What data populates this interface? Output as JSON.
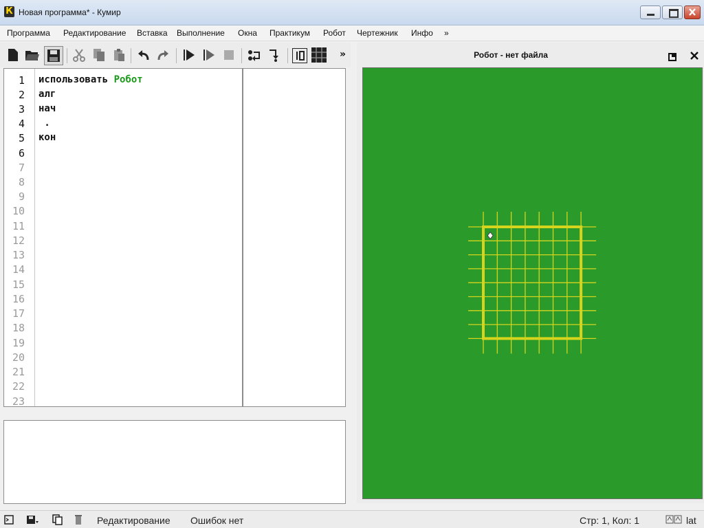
{
  "window": {
    "title": "Новая программа* - Кумир",
    "app_icon_letter": "К"
  },
  "menu": [
    "Программа",
    "Редактирование",
    "Вставка",
    "Выполнение",
    "Окна",
    "Практикум",
    "Робот",
    "Чертежник",
    "Инфо",
    "»"
  ],
  "toolbar": {
    "overflow": "»",
    "icons": [
      "new-file-icon",
      "open-folder-icon",
      "save-icon",
      "cut-icon",
      "copy-icon",
      "paste-icon",
      "undo-icon",
      "redo-icon",
      "run-icon",
      "step-run-icon",
      "stop-icon",
      "step-into-icon",
      "step-out-icon",
      "variables-icon",
      "grid-view-icon"
    ]
  },
  "editor": {
    "line_numbers": [
      "1",
      "2",
      "3",
      "4",
      "5",
      "6",
      "7",
      "8",
      "9",
      "10",
      "11",
      "12",
      "13",
      "14",
      "15",
      "16",
      "17",
      "18",
      "19",
      "20",
      "21",
      "22",
      "23"
    ],
    "lines": [
      {
        "keyword": "использовать",
        "module": "Робот"
      },
      {
        "text": "алг"
      },
      {
        "text": "нач"
      },
      {
        "text": " ."
      },
      {
        "text": "кон"
      }
    ]
  },
  "robot_panel": {
    "title": "Робот - нет файла",
    "field_color": "#2a9a2a",
    "grid_color": "#d6d41c",
    "grid_cols": 7,
    "grid_rows": 8
  },
  "statusbar": {
    "mode": "Редактирование",
    "errors": "Ошибок нет",
    "position": "Стр: 1, Кол: 1",
    "layout": "lat"
  }
}
